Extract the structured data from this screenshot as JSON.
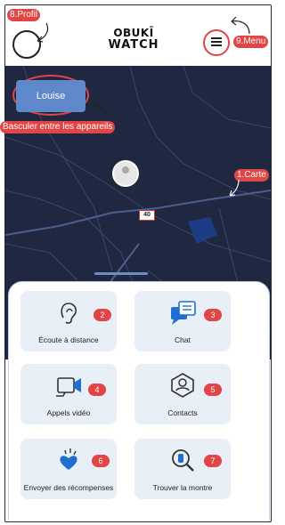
{
  "logo": {
    "line1": "OBUKĪ",
    "line2": "WATCH"
  },
  "device": {
    "name": "Louise"
  },
  "map": {
    "road_marker": "40"
  },
  "features": [
    {
      "label": "Écoute à distance",
      "badge": "2",
      "icon": "ear-icon"
    },
    {
      "label": "Chat",
      "badge": "3",
      "icon": "chat-icon"
    },
    {
      "label": "Appels vidéo",
      "badge": "4",
      "icon": "video-call-icon"
    },
    {
      "label": "Contacts",
      "badge": "5",
      "icon": "contacts-icon"
    },
    {
      "label": "Envoyer des récompenses",
      "badge": "6",
      "icon": "reward-icon"
    },
    {
      "label": "Trouver la montre",
      "badge": "7",
      "icon": "find-watch-icon"
    }
  ],
  "annotations": {
    "profile": "8.Profil",
    "menu": "9.Menu",
    "switch": "Basculer entre les appareils",
    "map": "1.Carte"
  },
  "colors": {
    "accent": "#e14545",
    "tile_bg": "#e9eff7",
    "button_blue": "#5e88c9",
    "map_bg": "#1f2840"
  }
}
